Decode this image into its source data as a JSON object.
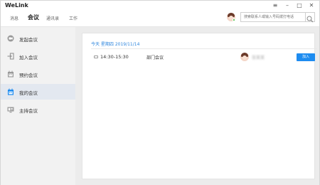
{
  "app": {
    "title": "WeLink"
  },
  "window_controls": {
    "menu": "≡",
    "minimize": "–",
    "maximize": "□",
    "close": "✕"
  },
  "nav": {
    "tabs": [
      {
        "label": "消息",
        "active": false
      },
      {
        "label": "会议",
        "active": true
      },
      {
        "label": "通讯录",
        "active": false
      },
      {
        "label": "工作",
        "active": false
      }
    ],
    "search_placeholder": "搜索联系人或输入号码拨打电话"
  },
  "sidebar": {
    "items": [
      {
        "label": "发起会议",
        "icon": "video-call-icon",
        "active": false
      },
      {
        "label": "加入会议",
        "icon": "join-arrow-icon",
        "active": false
      },
      {
        "label": "预约会议",
        "icon": "calendar-icon",
        "active": false
      },
      {
        "label": "我的会议",
        "icon": "my-calendar-icon",
        "active": true
      },
      {
        "label": "主持会议",
        "icon": "host-icon",
        "active": false
      }
    ]
  },
  "main": {
    "date_header": "今天 星期四 2019/11/14",
    "meetings": [
      {
        "time": "14:30-15:30",
        "subject": "部门会议",
        "organizer": "张某某",
        "join_label": "加入"
      }
    ]
  },
  "colors": {
    "accent": "#1e8cf0",
    "date_text": "#2e86de",
    "sidebar_bg": "#f2f2f2",
    "sidebar_active": "#e3e8f0",
    "main_bg": "#ececec"
  }
}
